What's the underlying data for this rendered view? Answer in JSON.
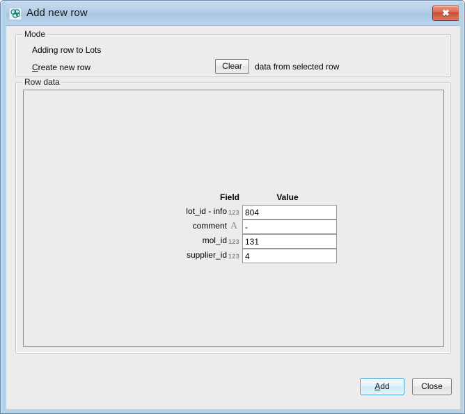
{
  "window": {
    "title": "Add new row",
    "icon": "molecule-icon",
    "close_label": "✖",
    "border_color": "#b4d2ea",
    "titlebar_color": "#b4cde6",
    "body_color": "#eeecea"
  },
  "mode_group": {
    "legend": "Mode",
    "line1": "Adding row to Lots",
    "line2_prefix": "C",
    "line2_rest": "reate new row",
    "clear_button": "Clear",
    "clear_suffix": "data from selected row"
  },
  "rowdata_group": {
    "legend": "Row data",
    "table": {
      "headers": {
        "field": "Field",
        "value": "Value"
      },
      "rows": [
        {
          "field": "lot_id - info",
          "type": "123",
          "type_name": "numeric-type-icon",
          "value": "804"
        },
        {
          "field": "comment",
          "type": "A",
          "type_name": "text-type-icon",
          "value": "-"
        },
        {
          "field": "mol_id",
          "type": "123",
          "type_name": "numeric-type-icon",
          "value": "131"
        },
        {
          "field": "supplier_id",
          "type": "123",
          "type_name": "numeric-type-icon",
          "value": "4"
        }
      ]
    }
  },
  "footer": {
    "add_mnemonic": "A",
    "add_rest": "dd",
    "close_label": "Close",
    "default_button_accent": "#3c96d4"
  }
}
